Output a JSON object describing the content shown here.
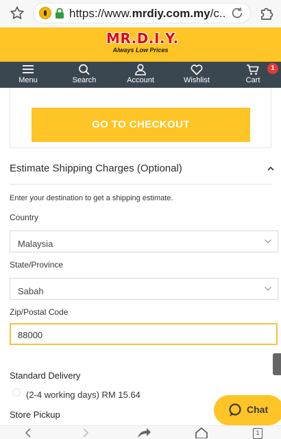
{
  "browser": {
    "url_prefix": "https://www.",
    "url_domain": "mrdiy.com.my",
    "url_suffix": "/c...",
    "tab_count": "1"
  },
  "brand": {
    "name": "MR.D.I.Y.",
    "tagline": "Always Low Prices",
    "accent_color": "#ffc425",
    "nav_color": "#3a4750"
  },
  "nav": {
    "menu": "Menu",
    "search": "Search",
    "account": "Account",
    "wishlist": "Wishlist",
    "cart": "Cart",
    "cart_count": "1"
  },
  "checkout": {
    "button_label": "GO TO CHECKOUT"
  },
  "shipping": {
    "title": "Estimate Shipping Charges (Optional)",
    "helper": "Enter your destination to get a shipping estimate.",
    "country_label": "Country",
    "country_value": "Malaysia",
    "state_label": "State/Province",
    "state_value": "Sabah",
    "zip_label": "Zip/Postal Code",
    "zip_value": "88000"
  },
  "delivery": {
    "standard_title": "Standard Delivery",
    "standard_option": "(2-4 working days) RM 15.64",
    "pickup_title": "Store Pickup"
  },
  "chat": {
    "label": "Chat"
  }
}
